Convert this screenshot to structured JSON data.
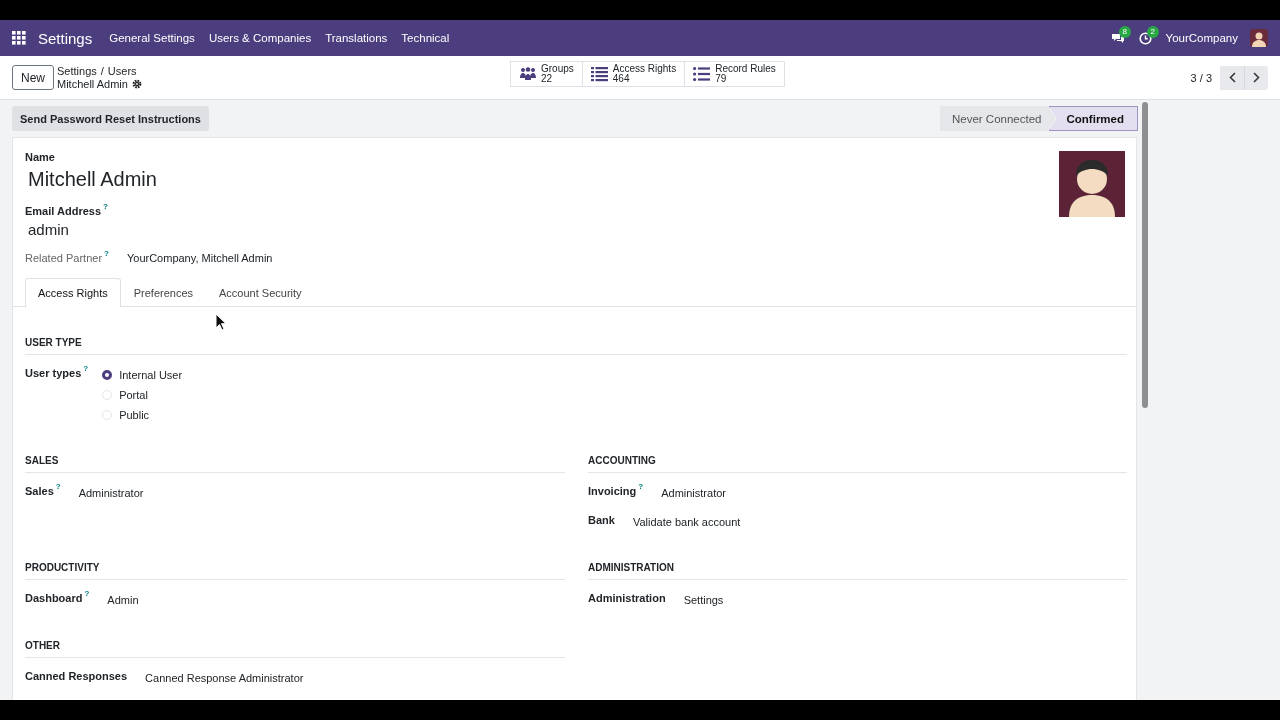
{
  "navbar": {
    "app": "Settings",
    "menus": [
      "General Settings",
      "Users & Companies",
      "Translations",
      "Technical"
    ],
    "messages_badge": "8",
    "activities_badge": "2",
    "company": "YourCompany"
  },
  "control_panel": {
    "new_button": "New",
    "breadcrumb": [
      "Settings",
      "Users"
    ],
    "separator": "/",
    "record": "Mitchell Admin",
    "pager": "3 / 3",
    "smart_buttons": [
      {
        "kind": "people",
        "label": "Groups",
        "value": "22"
      },
      {
        "kind": "list",
        "label": "Access Rights",
        "value": "464"
      },
      {
        "kind": "bullets",
        "label": "Record Rules",
        "value": "79"
      }
    ]
  },
  "action_buttons": [
    "Send Password Reset Instructions"
  ],
  "statusbar": [
    {
      "label": "Never Connected",
      "selected": false
    },
    {
      "label": "Confirmed",
      "selected": true
    }
  ],
  "form": {
    "name_label": "Name",
    "name": "Mitchell Admin",
    "email_label": "Email Address",
    "email_help": "?",
    "email": "admin",
    "partner_label": "Related Partner",
    "partner_help": "?",
    "partner": "YourCompany, Mitchell Admin"
  },
  "tabs": [
    {
      "label": "Access Rights",
      "selected": true
    },
    {
      "label": "Preferences",
      "selected": false
    },
    {
      "label": "Account Security",
      "selected": false
    }
  ],
  "sections": [
    {
      "title": "USER TYPE",
      "kind": "full",
      "fields": [
        {
          "kind": "radio",
          "label": "User types",
          "help": "?",
          "options": [
            {
              "label": "Internal User",
              "selected": true
            },
            {
              "label": "Portal",
              "selected": false
            },
            {
              "label": "Public",
              "selected": false
            }
          ]
        }
      ]
    },
    {
      "title": "SALES",
      "kind": "half",
      "fields": [
        {
          "kind": "value",
          "label": "Sales",
          "help": "?",
          "value": "Administrator"
        }
      ]
    },
    {
      "title": "ACCOUNTING",
      "kind": "half",
      "fields": [
        {
          "kind": "value",
          "label": "Invoicing",
          "help": "?",
          "value": "Administrator"
        },
        {
          "kind": "value",
          "label": "Bank",
          "value": "Validate bank account"
        }
      ]
    },
    {
      "title": "PRODUCTIVITY",
      "kind": "half",
      "fields": [
        {
          "kind": "value",
          "label": "Dashboard",
          "help": "?",
          "value": "Admin"
        }
      ]
    },
    {
      "title": "ADMINISTRATION",
      "kind": "half",
      "fields": [
        {
          "kind": "value",
          "label": "Administration",
          "value": "Settings"
        }
      ]
    },
    {
      "title": "OTHER",
      "kind": "half",
      "fields": [
        {
          "kind": "value",
          "label": "Canned Responses",
          "value": "Canned Response Administrator"
        }
      ]
    }
  ]
}
